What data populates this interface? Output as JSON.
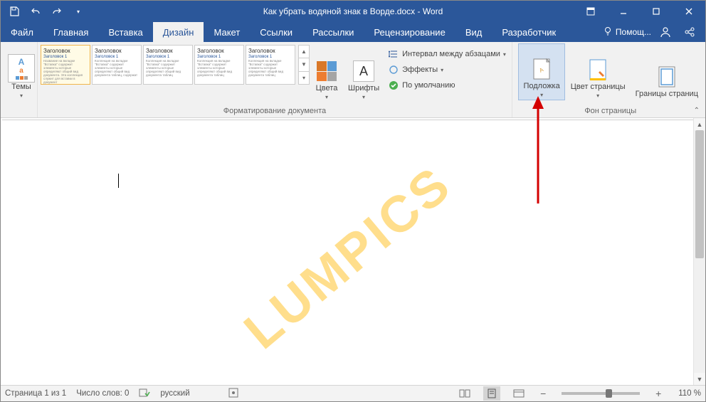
{
  "titlebar": {
    "title": "Как убрать водяной знак в Ворде.docx - Word"
  },
  "tabs": {
    "file": "Файл",
    "home": "Главная",
    "insert": "Вставка",
    "design": "Дизайн",
    "layout": "Макет",
    "references": "Ссылки",
    "mailings": "Рассылки",
    "review": "Рецензирование",
    "view": "Вид",
    "developer": "Разработчик",
    "tell_me": "Помощ..."
  },
  "ribbon": {
    "themes_label": "Темы",
    "themes_icon_text": "Aa",
    "style_header": "Заголовок",
    "style_sub": "Заголовок 1",
    "doc_formatting_label": "Форматирование документа",
    "colors_label": "Цвета",
    "fonts_label": "Шрифты",
    "fonts_icon_text": "A",
    "paragraph_spacing": "Интервал между абзацами",
    "effects": "Эффекты",
    "set_default": "По умолчанию",
    "watermark_label": "Подложка",
    "page_color_label": "Цвет страницы",
    "page_borders_label": "Границы страниц",
    "page_bg_group_label": "Фон страницы"
  },
  "document": {
    "watermark_text": "LUMPICS"
  },
  "statusbar": {
    "page": "Страница 1 из 1",
    "words": "Число слов: 0",
    "language": "русский",
    "zoom": "110 %"
  }
}
